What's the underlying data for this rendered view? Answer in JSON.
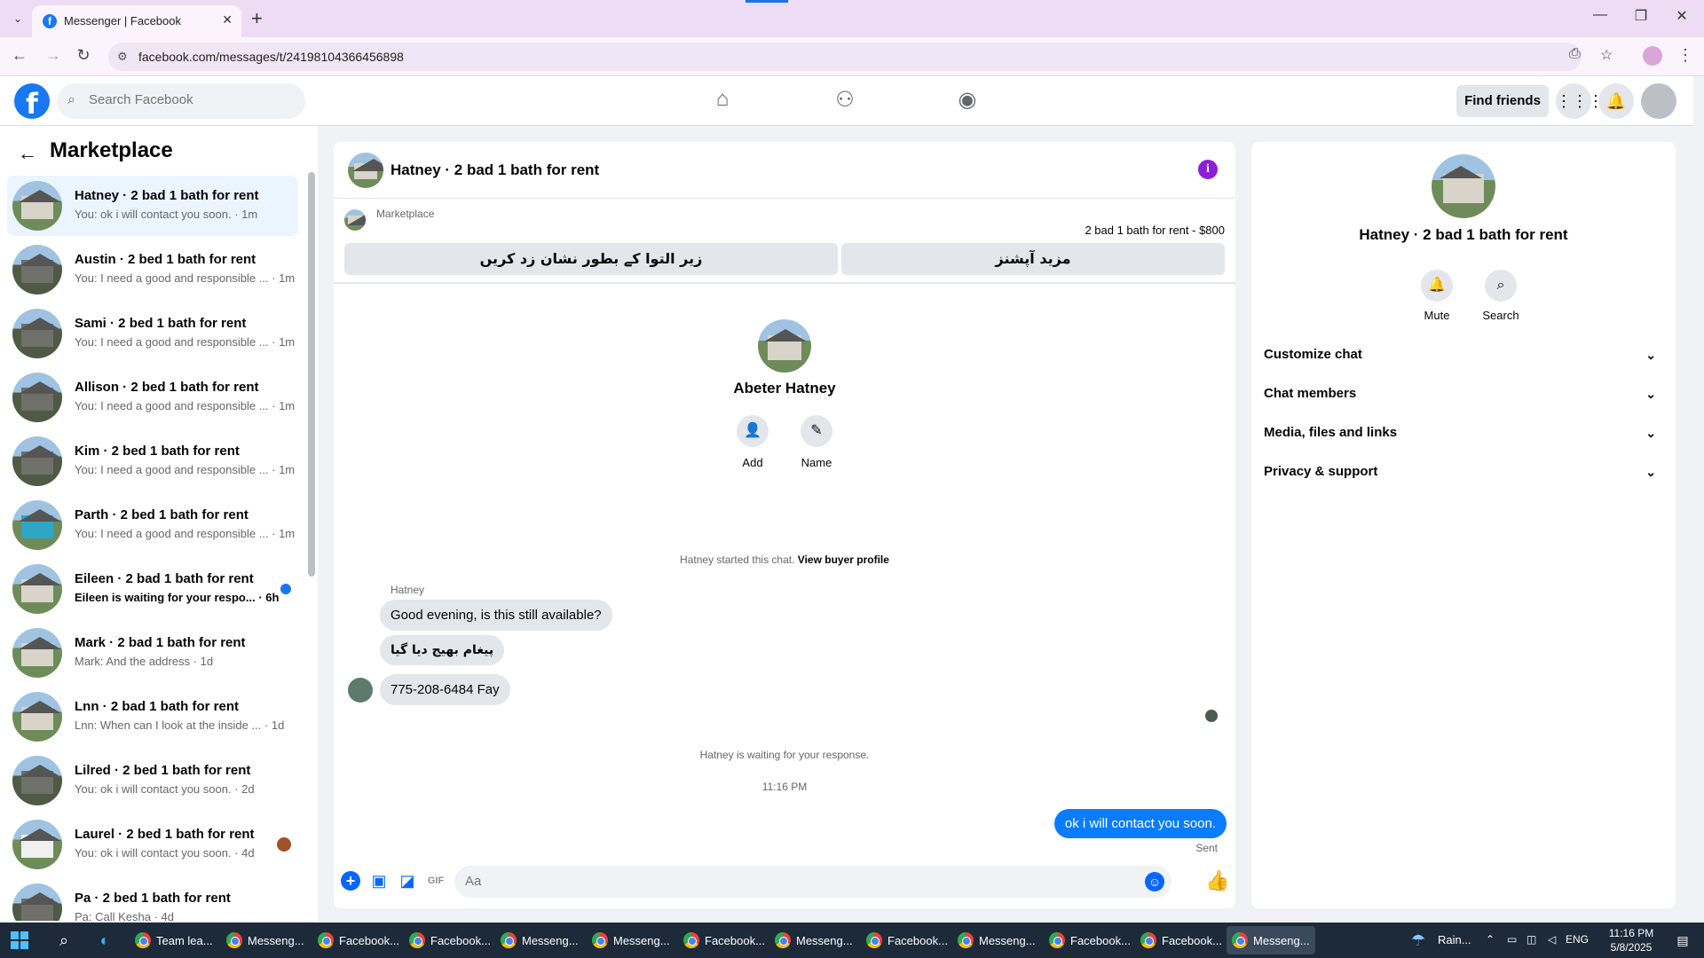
{
  "browser": {
    "tab_title": "Messenger | Facebook",
    "url": "facebook.com/messages/t/24198104366456898",
    "new_tab": "+",
    "minimize": "—",
    "restore": "❐",
    "close": "✕"
  },
  "fb": {
    "logo": "f",
    "search_placeholder": "Search Facebook",
    "find_friends": "Find friends"
  },
  "marketplace": {
    "title": "Marketplace",
    "conversations": [
      {
        "name": "Hatney · 2 bad 1 bath for rent",
        "preview": "You: ok i will contact you soon. · 1m",
        "style": "light"
      },
      {
        "name": "Austin · 2 bed 1 bath for rent",
        "preview": "You: I need a good and responsible ... · 1m",
        "style": "dark"
      },
      {
        "name": "Sami · 2 bed 1 bath for rent",
        "preview": "You: I need a good and responsible ... · 1m",
        "style": "dark"
      },
      {
        "name": "Allison · 2 bed 1 bath for rent",
        "preview": "You: I need a good and responsible ... · 1m",
        "style": "dark"
      },
      {
        "name": "Kim · 2 bed 1 bath for rent",
        "preview": "You: I need a good and responsible ... · 1m",
        "style": "dark"
      },
      {
        "name": "Parth · 2 bed 1 bath for rent",
        "preview": "You: I need a good and responsible ... · 1m",
        "style": "blue"
      },
      {
        "name": "Eileen · 2 bad 1 bath for rent",
        "preview": "Eileen is waiting for your respo... · 6h",
        "style": "light"
      },
      {
        "name": "Mark · 2 bad 1 bath for rent",
        "preview": "Mark: And the address · 1d",
        "style": "light"
      },
      {
        "name": "Lnn · 2 bad 1 bath for rent",
        "preview": "Lnn: When can I look at the inside ... · 1d",
        "style": "light"
      },
      {
        "name": "Lilred · 2 bed 1 bath for rent",
        "preview": "You: ok i will contact you soon. · 2d",
        "style": "dark"
      },
      {
        "name": "Laurel · 2 bed 1 bath for rent",
        "preview": "You: ok i will contact you soon. · 4d",
        "style": "white"
      },
      {
        "name": "Pa · 2 bed 1 bath for rent",
        "preview": "Pa: Call Kesha · 4d",
        "style": "dark"
      }
    ]
  },
  "chat": {
    "title": "Hatney · 2 bad 1 bath for rent",
    "marketplace_label": "Marketplace",
    "listing_price": "2 bad 1 bath for rent - $800",
    "btn_pending": "زیر التوا کے بطور نشان زد کریں",
    "btn_more": "مزید آپشنز",
    "profile_name": "Abeter Hatney",
    "add_label": "Add",
    "name_label": "Name",
    "started_text": "Hatney started this chat.",
    "view_buyer_profile": "View buyer profile",
    "sender": "Hatney",
    "messages": [
      "Good evening, is this still available?",
      "پیغام بھیج دیا گیا",
      "775-208-6484 Fay"
    ],
    "waiting_text": "Hatney is waiting for your response.",
    "time": "11:16 PM",
    "outgoing": "ok i will contact you soon.",
    "sent": "Sent",
    "composer_placeholder": "Aa"
  },
  "details": {
    "title": "Hatney · 2 bad 1 bath for rent",
    "mute": "Mute",
    "search": "Search",
    "sections": [
      "Customize chat",
      "Chat members",
      "Media, files and links",
      "Privacy & support"
    ]
  },
  "taskbar": {
    "apps": [
      {
        "label": "Team lea...",
        "active": false
      },
      {
        "label": "Messeng...",
        "active": false
      },
      {
        "label": "Facebook...",
        "active": false
      },
      {
        "label": "Facebook...",
        "active": false
      },
      {
        "label": "Messeng...",
        "active": false
      },
      {
        "label": "Messeng...",
        "active": false
      },
      {
        "label": "Facebook...",
        "active": false
      },
      {
        "label": "Messeng...",
        "active": false
      },
      {
        "label": "Facebook...",
        "active": false
      },
      {
        "label": "Messeng...",
        "active": false
      },
      {
        "label": "Facebook...",
        "active": false
      },
      {
        "label": "Facebook...",
        "active": false
      },
      {
        "label": "Messeng...",
        "active": true
      }
    ],
    "weather": "Rain...",
    "lang": "ENG",
    "time": "11:16 PM",
    "date": "5/8/2025"
  },
  "colors": {
    "fb_blue": "#1877f2",
    "messenger_blue": "#0a7cff",
    "info_purple": "#8b1fd8"
  }
}
